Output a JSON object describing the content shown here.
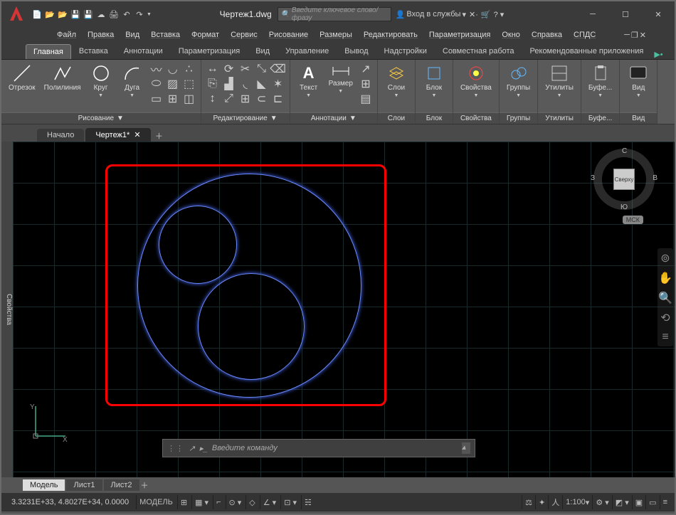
{
  "app": {
    "filename": "Чертеж1.dwg",
    "search_placeholder": "Введите ключевое слово/фразу",
    "login_label": "Вход в службы"
  },
  "menu": [
    "Файл",
    "Правка",
    "Вид",
    "Вставка",
    "Формат",
    "Сервис",
    "Рисование",
    "Размеры",
    "Редактировать",
    "Параметризация",
    "Окно",
    "Справка",
    "СПДС"
  ],
  "ribbon_tabs": [
    "Главная",
    "Вставка",
    "Аннотации",
    "Параметризация",
    "Вид",
    "Управление",
    "Вывод",
    "Надстройки",
    "Совместная работа",
    "Рекомендованные приложения"
  ],
  "ribbon": {
    "draw": {
      "title": "Рисование",
      "line": "Отрезок",
      "pline": "Полилиния",
      "circle": "Круг",
      "arc": "Дуга"
    },
    "edit": {
      "title": "Редактирование"
    },
    "annot": {
      "title": "Аннотации",
      "text": "Текст",
      "dim": "Размер"
    },
    "layers": {
      "title": "Слои",
      "btn": "Слои"
    },
    "block": {
      "title": "Блок",
      "btn": "Блок"
    },
    "props": {
      "title": "Свойства",
      "btn": "Свойства"
    },
    "groups": {
      "title": "Группы",
      "btn": "Группы"
    },
    "utils": {
      "title": "Утилиты",
      "btn": "Утилиты"
    },
    "clip": {
      "title": "Буфе...",
      "btn": "Буфе..."
    },
    "view": {
      "title": "Вид",
      "btn": "Вид"
    }
  },
  "file_tabs": {
    "start": "Начало",
    "drawing": "Чертеж1*"
  },
  "side_palette": "Свойства",
  "viewcube": {
    "top": "Сверху",
    "n": "С",
    "s": "Ю",
    "w": "З",
    "e": "В",
    "msk": "МСК"
  },
  "cmd": {
    "placeholder": "Введите команду"
  },
  "layout_tabs": [
    "Модель",
    "Лист1",
    "Лист2"
  ],
  "status": {
    "coords": "3.3231E+33, 4.8027E+34, 0.0000",
    "model": "МОДЕЛЬ",
    "scale": "1:100"
  }
}
